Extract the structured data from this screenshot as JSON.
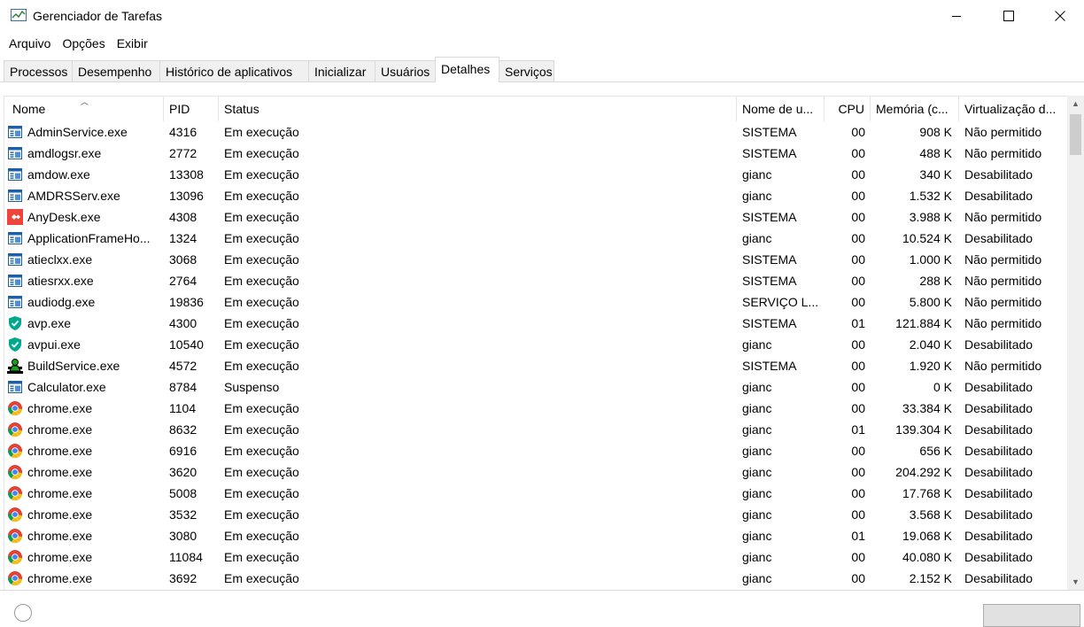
{
  "window": {
    "title": "Gerenciador de Tarefas"
  },
  "menu": [
    "Arquivo",
    "Opções",
    "Exibir"
  ],
  "tabs": [
    "Processos",
    "Desempenho",
    "Histórico de aplicativos",
    "Inicializar",
    "Usuários",
    "Detalhes",
    "Serviços"
  ],
  "active_tab": "Detalhes",
  "columns": {
    "name": "Nome",
    "pid": "PID",
    "status": "Status",
    "user": "Nome de u...",
    "cpu": "CPU",
    "memory": "Memória (c...",
    "virtualization": "Virtualização d..."
  },
  "rows": [
    {
      "icon": "app-window-icon",
      "name": "AdminService.exe",
      "pid": "4316",
      "status": "Em execução",
      "user": "SISTEMA",
      "cpu": "00",
      "memory": "908 K",
      "virt": "Não permitido"
    },
    {
      "icon": "app-window-icon",
      "name": "amdlogsr.exe",
      "pid": "2772",
      "status": "Em execução",
      "user": "SISTEMA",
      "cpu": "00",
      "memory": "488 K",
      "virt": "Não permitido"
    },
    {
      "icon": "app-window-icon",
      "name": "amdow.exe",
      "pid": "13308",
      "status": "Em execução",
      "user": "gianc",
      "cpu": "00",
      "memory": "340 K",
      "virt": "Desabilitado"
    },
    {
      "icon": "app-window-icon",
      "name": "AMDRSServ.exe",
      "pid": "13096",
      "status": "Em execução",
      "user": "gianc",
      "cpu": "00",
      "memory": "1.532 K",
      "virt": "Desabilitado"
    },
    {
      "icon": "anydesk-icon",
      "name": "AnyDesk.exe",
      "pid": "4308",
      "status": "Em execução",
      "user": "SISTEMA",
      "cpu": "00",
      "memory": "3.988 K",
      "virt": "Não permitido"
    },
    {
      "icon": "app-window-icon",
      "name": "ApplicationFrameHo...",
      "pid": "1324",
      "status": "Em execução",
      "user": "gianc",
      "cpu": "00",
      "memory": "10.524 K",
      "virt": "Desabilitado"
    },
    {
      "icon": "app-window-icon",
      "name": "atieclxx.exe",
      "pid": "3068",
      "status": "Em execução",
      "user": "SISTEMA",
      "cpu": "00",
      "memory": "1.000 K",
      "virt": "Não permitido"
    },
    {
      "icon": "app-window-icon",
      "name": "atiesrxx.exe",
      "pid": "2764",
      "status": "Em execução",
      "user": "SISTEMA",
      "cpu": "00",
      "memory": "288 K",
      "virt": "Não permitido"
    },
    {
      "icon": "app-window-icon",
      "name": "audiodg.exe",
      "pid": "19836",
      "status": "Em execução",
      "user": "SERVIÇO L...",
      "cpu": "00",
      "memory": "5.800 K",
      "virt": "Não permitido"
    },
    {
      "icon": "shield-icon",
      "name": "avp.exe",
      "pid": "4300",
      "status": "Em execução",
      "user": "SISTEMA",
      "cpu": "01",
      "memory": "121.884 K",
      "virt": "Não permitido"
    },
    {
      "icon": "shield-icon",
      "name": "avpui.exe",
      "pid": "10540",
      "status": "Em execução",
      "user": "gianc",
      "cpu": "00",
      "memory": "2.040 K",
      "virt": "Desabilitado"
    },
    {
      "icon": "build-service-icon",
      "name": "BuildService.exe",
      "pid": "4572",
      "status": "Em execução",
      "user": "SISTEMA",
      "cpu": "00",
      "memory": "1.920 K",
      "virt": "Não permitido"
    },
    {
      "icon": "app-window-icon",
      "name": "Calculator.exe",
      "pid": "8784",
      "status": "Suspenso",
      "user": "gianc",
      "cpu": "00",
      "memory": "0 K",
      "virt": "Desabilitado"
    },
    {
      "icon": "chrome-icon",
      "name": "chrome.exe",
      "pid": "1104",
      "status": "Em execução",
      "user": "gianc",
      "cpu": "00",
      "memory": "33.384 K",
      "virt": "Desabilitado"
    },
    {
      "icon": "chrome-icon",
      "name": "chrome.exe",
      "pid": "8632",
      "status": "Em execução",
      "user": "gianc",
      "cpu": "01",
      "memory": "139.304 K",
      "virt": "Desabilitado"
    },
    {
      "icon": "chrome-icon",
      "name": "chrome.exe",
      "pid": "6916",
      "status": "Em execução",
      "user": "gianc",
      "cpu": "00",
      "memory": "656 K",
      "virt": "Desabilitado"
    },
    {
      "icon": "chrome-icon",
      "name": "chrome.exe",
      "pid": "3620",
      "status": "Em execução",
      "user": "gianc",
      "cpu": "00",
      "memory": "204.292 K",
      "virt": "Desabilitado"
    },
    {
      "icon": "chrome-icon",
      "name": "chrome.exe",
      "pid": "5008",
      "status": "Em execução",
      "user": "gianc",
      "cpu": "00",
      "memory": "17.768 K",
      "virt": "Desabilitado"
    },
    {
      "icon": "chrome-icon",
      "name": "chrome.exe",
      "pid": "3532",
      "status": "Em execução",
      "user": "gianc",
      "cpu": "00",
      "memory": "3.568 K",
      "virt": "Desabilitado"
    },
    {
      "icon": "chrome-icon",
      "name": "chrome.exe",
      "pid": "3080",
      "status": "Em execução",
      "user": "gianc",
      "cpu": "01",
      "memory": "19.068 K",
      "virt": "Desabilitado"
    },
    {
      "icon": "chrome-icon",
      "name": "chrome.exe",
      "pid": "11084",
      "status": "Em execução",
      "user": "gianc",
      "cpu": "00",
      "memory": "40.080 K",
      "virt": "Desabilitado"
    },
    {
      "icon": "chrome-icon",
      "name": "chrome.exe",
      "pid": "3692",
      "status": "Em execução",
      "user": "gianc",
      "cpu": "00",
      "memory": "2.152 K",
      "virt": "Desabilitado"
    }
  ]
}
